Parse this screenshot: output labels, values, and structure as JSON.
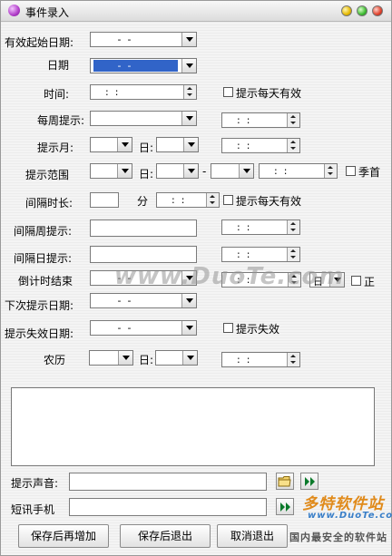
{
  "window": {
    "title": "事件录入"
  },
  "labels": {
    "valid_start_date": "有效起始日期:",
    "date": "日期",
    "time": "时间:",
    "weekly": "每周提示:",
    "month": "提示月:",
    "range": "提示范围",
    "interval": "间隔时长:",
    "interval_week": "间隔周提示:",
    "interval_day": "间隔日提示:",
    "countdown_end": "倒计时结束",
    "next_date": "下次提示日期:",
    "expire_date": "提示失效日期:",
    "lunar": "农历",
    "sound": "提示声音:",
    "sms": "短讯手机",
    "day": "日:",
    "minute": "分",
    "dash": "-"
  },
  "values": {
    "empty_date": " -  -",
    "empty_time": ":  :",
    "countdown_unit": "日"
  },
  "checkboxes": {
    "daily_valid": "提示每天有效",
    "quarter_first": "季首",
    "interval_daily_valid": "提示每天有效",
    "positive": "正",
    "expire": "提示失效"
  },
  "buttons": {
    "save_add": "保存后再增加",
    "save_exit": "保存后退出",
    "cancel_exit": "取消退出"
  },
  "watermark": {
    "main": "www.DuoTe.com",
    "logo": "多特软件站",
    "logo_url": "www.DuoTe.com",
    "slogan": "国内最安全的软件站"
  },
  "colors": {
    "selection": "#3164c8",
    "accent": "#0a7a2a"
  }
}
